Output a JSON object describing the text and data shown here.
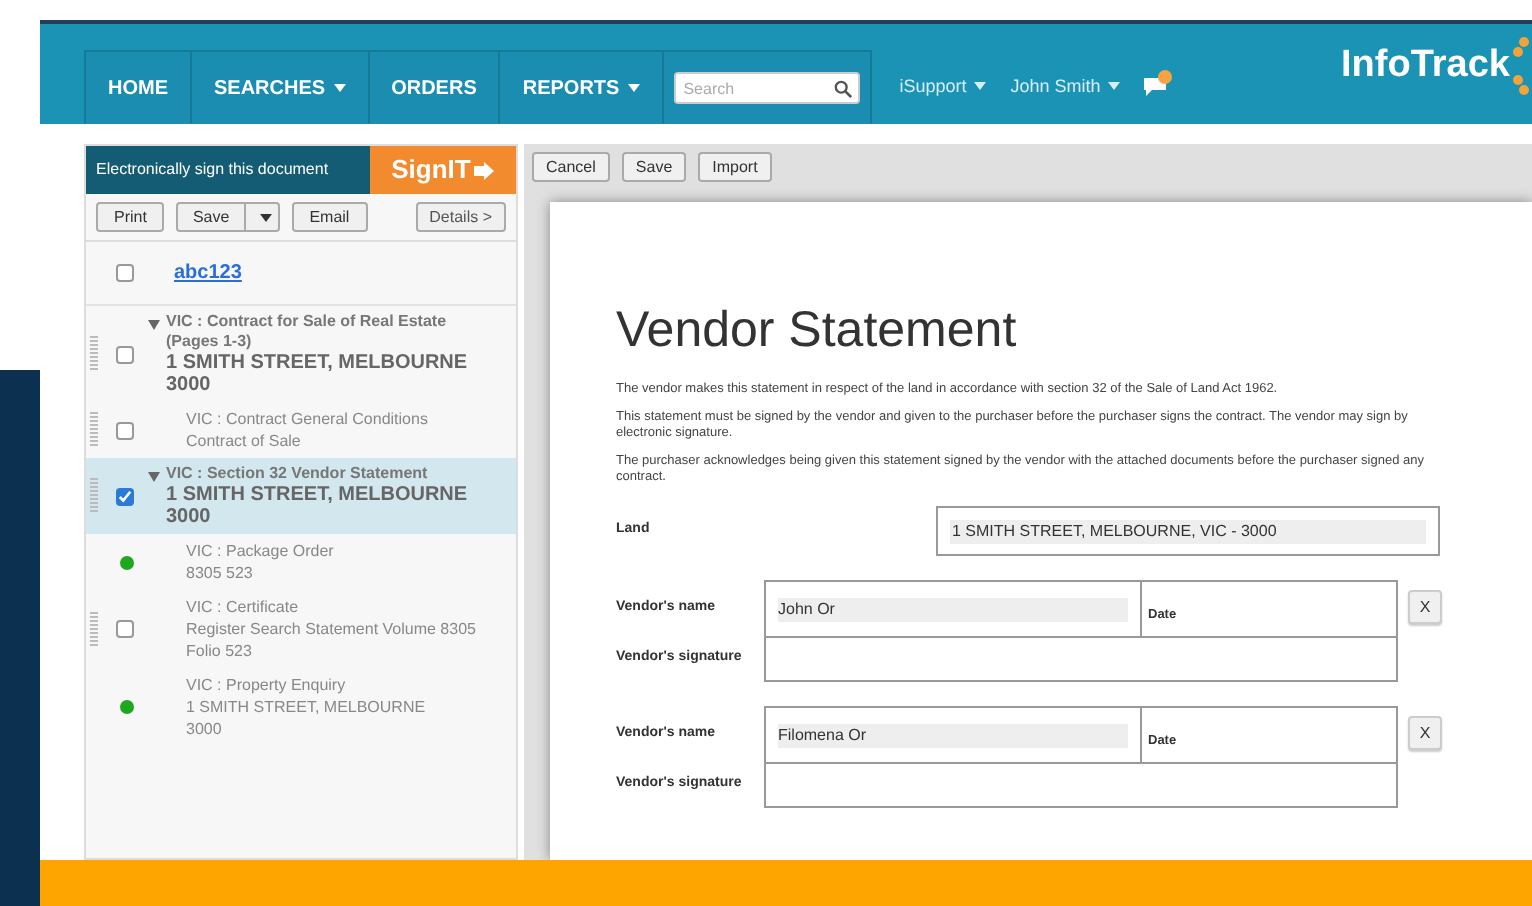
{
  "nav": {
    "items": [
      {
        "label": "HOME",
        "dropdown": false
      },
      {
        "label": "SEARCHES",
        "dropdown": true
      },
      {
        "label": "ORDERS",
        "dropdown": false
      },
      {
        "label": "REPORTS",
        "dropdown": true
      }
    ],
    "search": {
      "placeholder": "Search"
    },
    "links": [
      {
        "label": "iSupport"
      },
      {
        "label": "John Smith"
      }
    ],
    "messages": {
      "has_unread": true
    },
    "logo": "InfoTrack"
  },
  "sidebar": {
    "sign_banner": {
      "text": "Electronically sign this document",
      "button": "SignIT"
    },
    "buttons": [
      {
        "label": "Print",
        "kind": "plain"
      },
      {
        "label": "Save",
        "kind": "split"
      },
      {
        "label": "Email",
        "kind": "plain"
      }
    ],
    "details_button": "Details >",
    "items": [
      {
        "kind": "link",
        "lines": [
          "abc123"
        ],
        "checked": false
      },
      {
        "kind": "group",
        "lines": [
          "VIC : Contract for Sale of Real Estate",
          "(Pages 1-3)",
          "1 SMITH STREET, MELBOURNE",
          "3000"
        ],
        "checked": false,
        "selected": false,
        "expanded": true,
        "children": [
          {
            "kind": "checkbox",
            "lines": [
              "VIC : Contract General Conditions",
              "Contract of Sale"
            ],
            "checked": false
          }
        ]
      },
      {
        "kind": "group",
        "lines": [
          "VIC : Section 32 Vendor Statement",
          "1 SMITH STREET, MELBOURNE",
          "3000"
        ],
        "checked": true,
        "selected": true,
        "expanded": true,
        "children": [
          {
            "kind": "dot",
            "lines": [
              "VIC : Package Order",
              "8305 523"
            ],
            "color": "#1fa81f"
          },
          {
            "kind": "checkbox",
            "lines": [
              "VIC : Certificate",
              "Register Search Statement Volume 8305",
              "Folio 523"
            ],
            "checked": false
          },
          {
            "kind": "dot",
            "lines": [
              "VIC : Property Enquiry",
              "1 SMITH STREET, MELBOURNE",
              "3000"
            ],
            "color": "#1fa81f"
          }
        ]
      }
    ]
  },
  "toolbar": [
    "Cancel",
    "Save",
    "Import"
  ],
  "document": {
    "title": "Vendor Statement",
    "paragraphs": [
      "The vendor makes this statement in respect of the land in accordance with section 32 of the Sale of Land Act 1962.",
      "This statement must be signed by the vendor and given to the purchaser before the purchaser signs the contract. The vendor may sign by electronic signature.",
      "The purchaser acknowledges being given this statement signed by the vendor with the attached documents before the purchaser signed any contract."
    ],
    "land": {
      "label": "Land",
      "value": "1 SMITH STREET, MELBOURNE, VIC - 3000"
    },
    "vendors": [
      {
        "name_label": "Vendor's name",
        "name": "John Or",
        "date_label": "Date",
        "signature_label": "Vendor's signature",
        "remove": "X"
      },
      {
        "name_label": "Vendor's name",
        "name": "Filomena Or",
        "date_label": "Date",
        "signature_label": "Vendor's signature",
        "remove": "X"
      }
    ]
  }
}
